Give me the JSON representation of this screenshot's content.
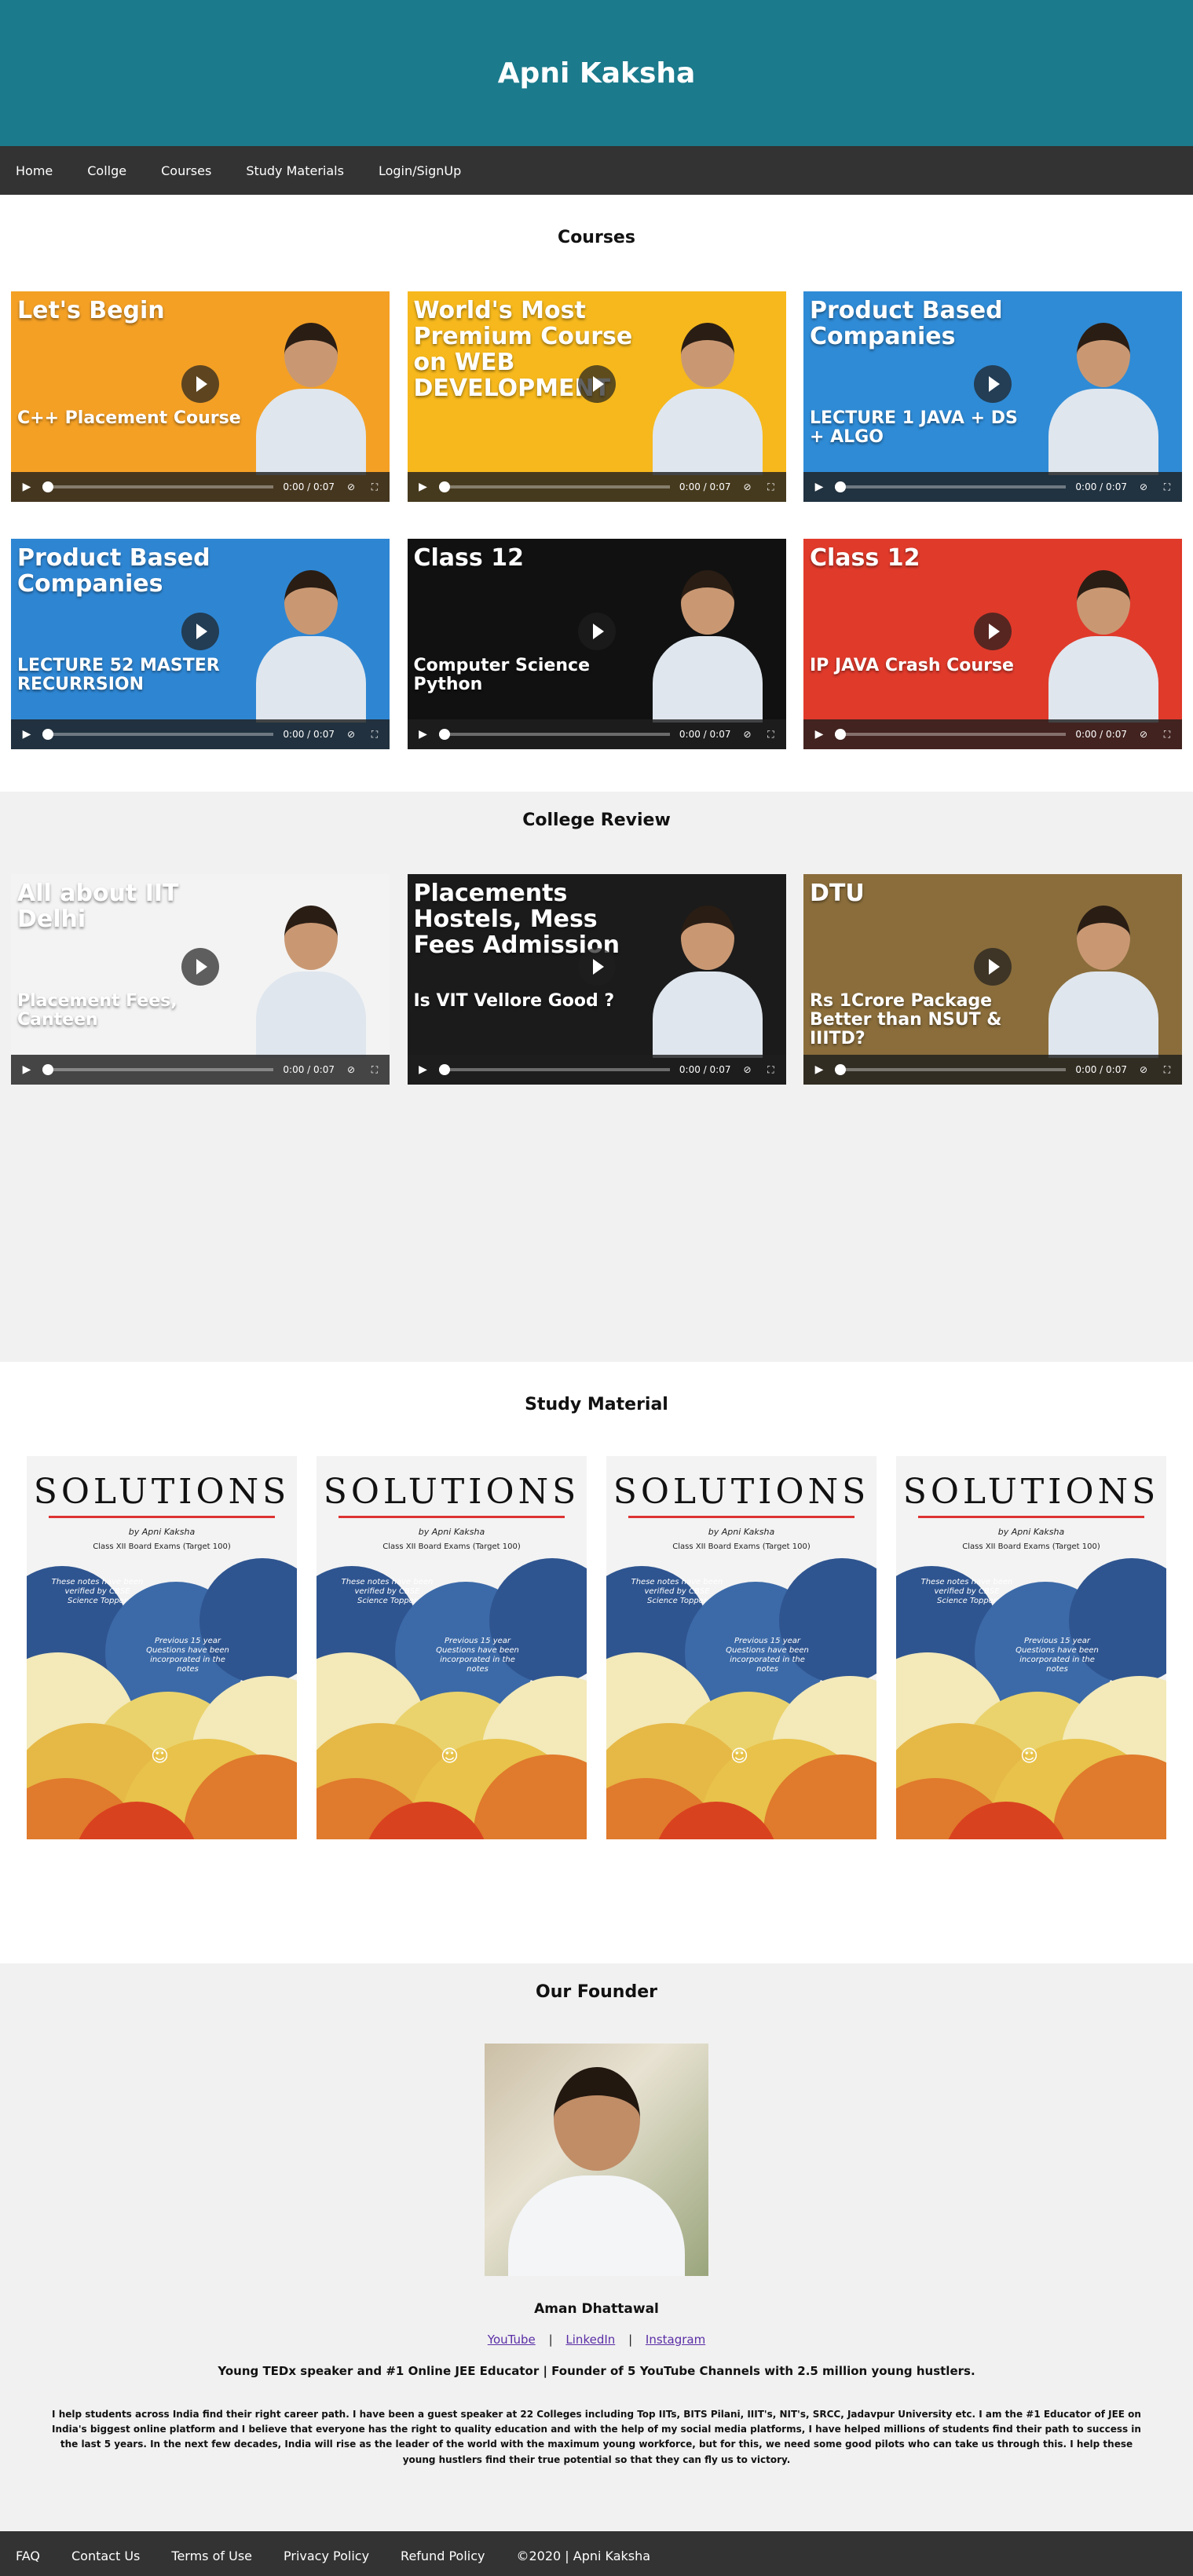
{
  "header": {
    "title": "Apni Kaksha"
  },
  "nav": {
    "items": [
      "Home",
      "Collge",
      "Courses",
      "Study Materials",
      "Login/SignUp"
    ]
  },
  "courses": {
    "title": "Courses",
    "videos": [
      {
        "thumb": "Let's Begin",
        "sub": "C++ Placement Course",
        "time": "0:00 / 0:07",
        "bg": "#f4a025"
      },
      {
        "thumb": "World's Most Premium Course on WEB DEVELOPMENT",
        "sub": "",
        "time": "0:00 / 0:07",
        "bg": "#f6b81c"
      },
      {
        "thumb": "Product Based Companies",
        "sub": "LECTURE 1 JAVA + DS + ALGO",
        "time": "0:00 / 0:07",
        "bg": "#2f8bd6"
      },
      {
        "thumb": "Product Based Companies",
        "sub": "LECTURE 52 MASTER RECURRSION",
        "time": "0:00 / 0:07",
        "bg": "#2e86d3"
      },
      {
        "thumb": "Class 12",
        "sub": "Computer Science Python",
        "time": "0:00 / 0:07",
        "bg": "#111111"
      },
      {
        "thumb": "Class 12",
        "sub": "IP JAVA Crash Course",
        "time": "0:00 / 0:07",
        "bg": "#e03a2b"
      }
    ]
  },
  "review": {
    "title": "College Review",
    "videos": [
      {
        "thumb": "All about IIT Delhi",
        "sub": "Placement Fees, Canteen",
        "time": "0:00 / 0:07",
        "bg": "#f3f3f3"
      },
      {
        "thumb": "Placements Hostels, Mess Fees Admission",
        "sub": "Is VIT Vellore Good ?",
        "time": "0:00 / 0:07",
        "bg": "#1b1b1b"
      },
      {
        "thumb": "DTU",
        "sub": "Rs 1Crore Package Better than NSUT & IIITD?",
        "time": "0:00 / 0:07",
        "bg": "#8a6d3b"
      }
    ]
  },
  "study": {
    "title": "Study Material",
    "books": [
      {
        "title": "SOLUTIONS",
        "by": "by Apni Kaksha",
        "sub": "Class XII Board Exams (Target 100)",
        "note1": "These notes have been verified by CBSE Science Topper",
        "note2": "Previous 15 year Questions have been incorporated in the notes"
      },
      {
        "title": "SOLUTIONS",
        "by": "by Apni Kaksha",
        "sub": "Class XII Board Exams (Target 100)",
        "note1": "These notes have been verified by CBSE Science Topper",
        "note2": "Previous 15 year Questions have been incorporated in the notes"
      },
      {
        "title": "SOLUTIONS",
        "by": "by Apni Kaksha",
        "sub": "Class XII Board Exams (Target 100)",
        "note1": "These notes have been verified by CBSE Science Topper",
        "note2": "Previous 15 year Questions have been incorporated in the notes"
      },
      {
        "title": "SOLUTIONS",
        "by": "by Apni Kaksha",
        "sub": "Class XII Board Exams (Target 100)",
        "note1": "These notes have been verified by CBSE Science Topper",
        "note2": "Previous 15 year Questions have been incorporated in the notes"
      }
    ]
  },
  "founder": {
    "title": "Our Founder",
    "name": "Aman Dhattawal",
    "links": [
      "YouTube",
      "LinkedIn",
      "Instagram"
    ],
    "tagline": "Young TEDx speaker and #1 Online JEE Educator | Founder of 5 YouTube Channels with 2.5 million young hustlers.",
    "bio": "I help students across India find their right career path. I have been a guest speaker at 22 Colleges including Top IITs, BITS Pilani, IIIT's, NIT's, SRCC, Jadavpur University etc. I am the #1 Educator of JEE on India's biggest online platform and I believe that everyone has the right to quality education and with the help of my social media platforms, I have helped millions of students find their path to success in the last 5 years. In the next few decades, India will rise as the leader of the world with the maximum young workforce, but for this, we need some good pilots who can take us through this. I help these young hustlers find their true potential so that they can fly us to victory."
  },
  "footer": {
    "items": [
      "FAQ",
      "Contact Us",
      "Terms of Use",
      "Privacy Policy",
      "Refund Policy"
    ],
    "copyright": "©2020 | Apni Kaksha"
  }
}
